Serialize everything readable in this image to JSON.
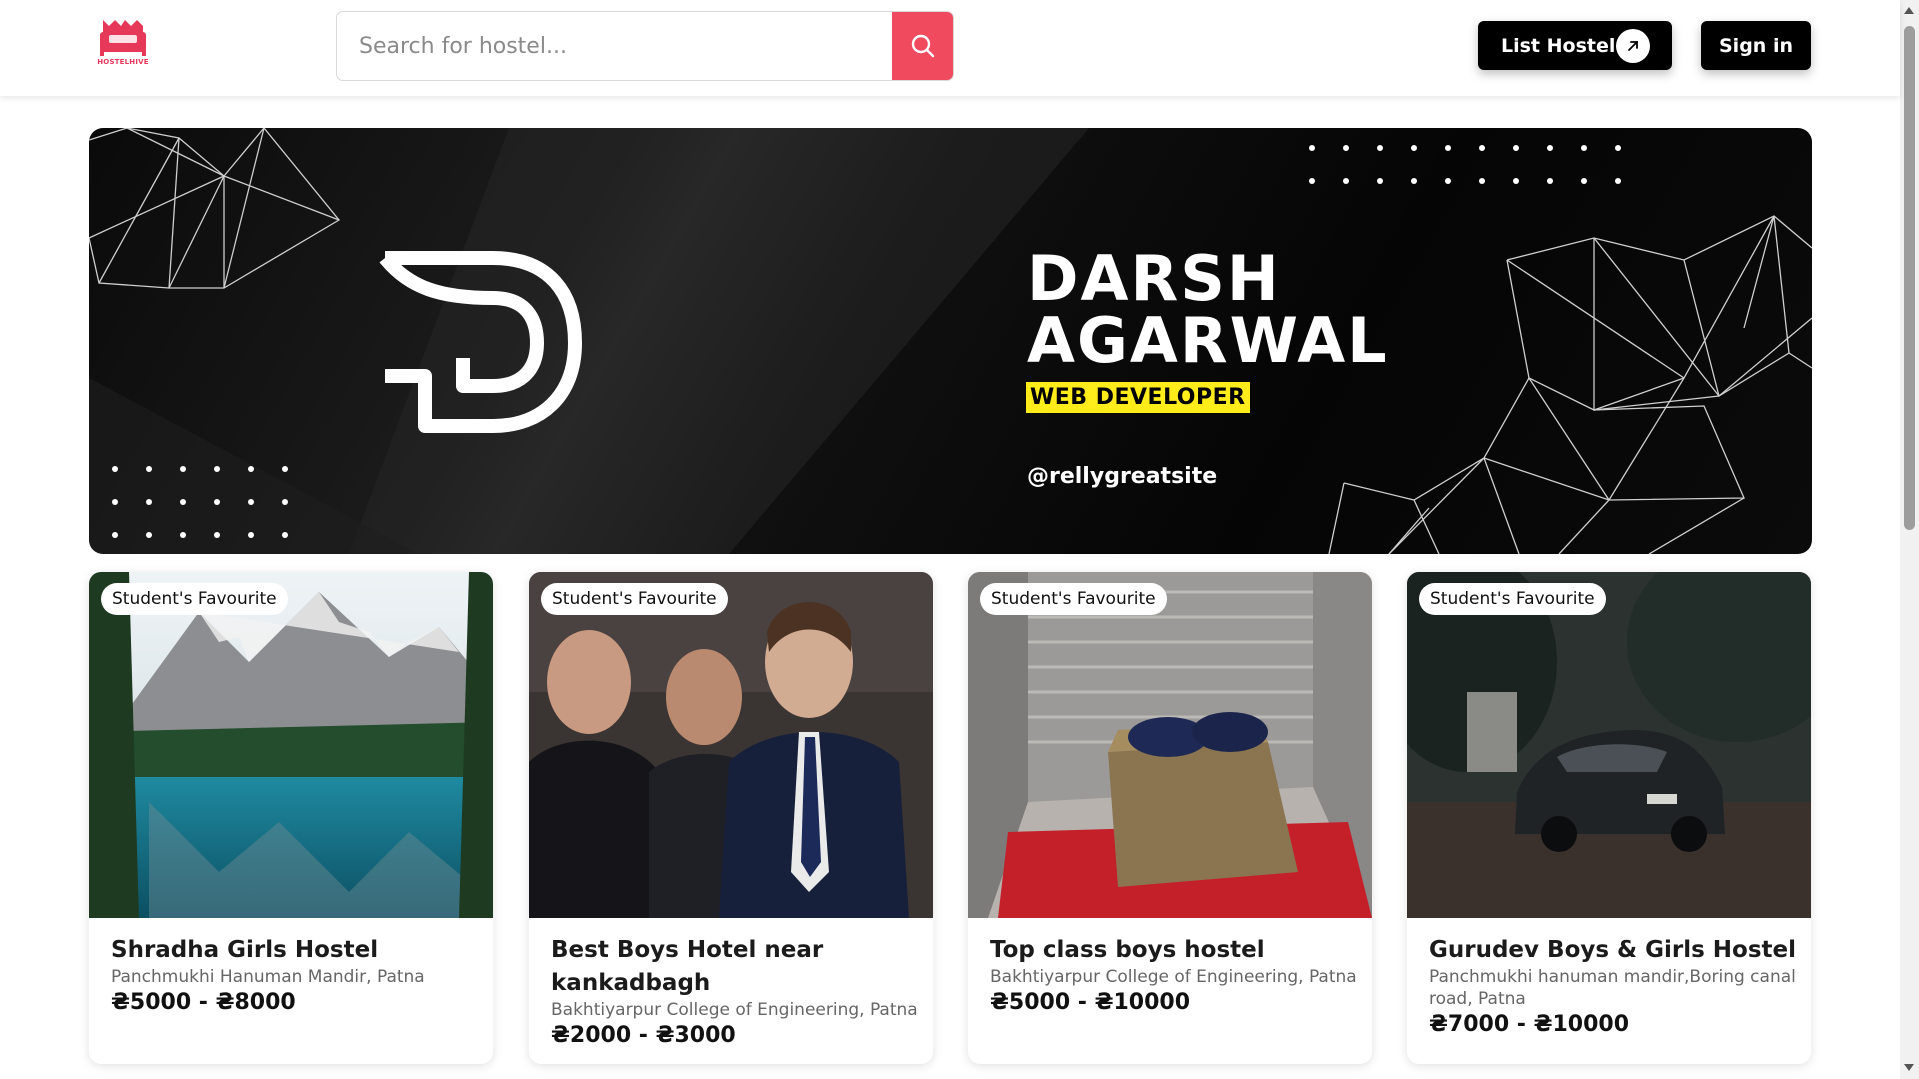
{
  "header": {
    "logo_text": "HOSTELHIVE",
    "search": {
      "placeholder": "Search for hostel...",
      "value": ""
    },
    "list_hostel_label": "List Hostel",
    "sign_in_label": "Sign in"
  },
  "banner": {
    "name_line1": "DARSH",
    "name_line2": "AGARWAL",
    "role": "WEB DEVELOPER",
    "handle": "@rellygreatsite"
  },
  "cards": [
    {
      "badge": "Student's Favourite",
      "title": "Shradha Girls Hostel",
      "location": "Panchmukhi Hanuman Mandir, Patna",
      "price": "₴5000 - ₴8000"
    },
    {
      "badge": "Student's Favourite",
      "title": "Best Boys Hotel near kankadbagh",
      "location": "Bakhtiyarpur College of Engineering, Patna",
      "price": "₴2000 - ₴3000"
    },
    {
      "badge": "Student's Favourite",
      "title": "Top class boys hostel",
      "location": "Bakhtiyarpur College of Engineering, Patna",
      "price": "₴5000 - ₴10000"
    },
    {
      "badge": "Student's Favourite",
      "title": "Gurudev Boys & Girls Hostel",
      "location": "Panchmukhi hanuman mandir,Boring canal road, Patna",
      "price": "₴7000 - ₴10000"
    }
  ],
  "colors": {
    "brand": "#ef4a5e",
    "dark_button": "#000000",
    "highlight": "#ffec1a"
  }
}
